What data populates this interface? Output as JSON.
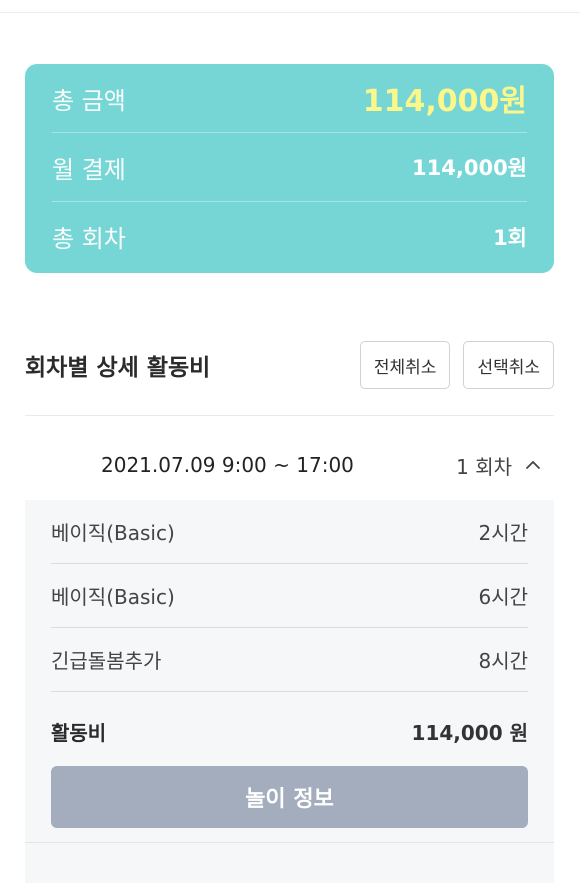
{
  "summary": {
    "total_label": "총 금액",
    "total_value": "114,000원",
    "monthly_label": "월 결제",
    "monthly_value": "114,000원",
    "sessions_label": "총 회차",
    "sessions_value": "1회"
  },
  "section": {
    "title": "회차별 상세 활동비",
    "cancel_all": "전체취소",
    "cancel_selected": "선택취소"
  },
  "session": {
    "date_range": "2021.07.09  9:00 ~ 17:00",
    "count_label": "1 회차",
    "items": [
      {
        "name": "베이직(Basic)",
        "duration": "2시간"
      },
      {
        "name": "베이직(Basic)",
        "duration": "6시간"
      },
      {
        "name": "긴급돌봄추가",
        "duration": "8시간"
      }
    ],
    "fee_label": "활동비",
    "fee_value": "114,000 원",
    "play_info_button": "놀이 정보"
  },
  "colors": {
    "summary_bg": "#76d6d6",
    "total_highlight": "#fbf78a",
    "button_disabled": "#a3adbd"
  }
}
